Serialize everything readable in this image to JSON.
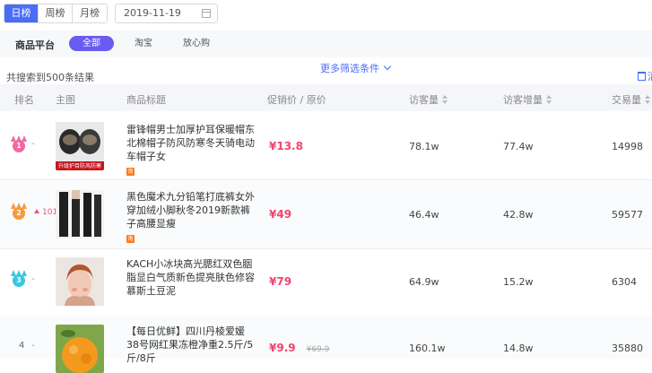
{
  "tabs": [
    "日榜",
    "周榜",
    "月榜"
  ],
  "active_tab": 0,
  "date": "2019-11-19",
  "platform": {
    "label": "商品平台",
    "options": [
      "全部",
      "淘宝",
      "放心购"
    ]
  },
  "more_filters": "更多筛选条件",
  "result_count": "共搜索到500条结果",
  "clear_label": "清",
  "columns": [
    "排名",
    "主图",
    "商品标题",
    "促销价 / 原价",
    "访客量",
    "访客增量",
    "交易量"
  ],
  "rows": [
    {
      "rank": "1",
      "rank_change": "-",
      "title": "雷锋帽男士加厚护耳保暖帽东北棉帽子防风防寒冬天骑电动车帽子女",
      "platform_tag": "淘",
      "price": "¥13.8",
      "original_price": "",
      "visitors": "78.1w",
      "visitor_increase": "77.4w",
      "transactions": "14998",
      "thumb_caption": "升级护目防风防寒"
    },
    {
      "rank": "2",
      "rank_change": "101",
      "title": "黑色魔术九分铅笔打底裤女外穿加绒小脚秋冬2019新款裤子高腰显瘦",
      "platform_tag": "淘",
      "price": "¥49",
      "original_price": "",
      "visitors": "46.4w",
      "visitor_increase": "42.8w",
      "transactions": "59577",
      "thumb_caption": ""
    },
    {
      "rank": "3",
      "rank_change": "-",
      "title": "KACH小冰块高光腮红双色胭脂显白气质新色提亮肤色修容慕斯土豆泥",
      "platform_tag": "淘",
      "price": "¥79",
      "original_price": "",
      "visitors": "64.9w",
      "visitor_increase": "15.2w",
      "transactions": "6304",
      "thumb_caption": ""
    },
    {
      "rank": "4",
      "rank_change": "-",
      "title": "【每日优鲜】四川丹棱爱媛38号网红果冻橙净重2.5斤/5斤/8斤",
      "platform_tag": "",
      "price": "¥9.9",
      "original_price": "¥69.9",
      "visitors": "160.1w",
      "visitor_increase": "14.8w",
      "transactions": "35880",
      "thumb_caption": ""
    }
  ],
  "colors": {
    "accent": "#4a6cf7",
    "price": "#f5416c",
    "rank1": "#f06aa0",
    "rank2": "#f79a3a",
    "rank3": "#3cc6e0"
  }
}
